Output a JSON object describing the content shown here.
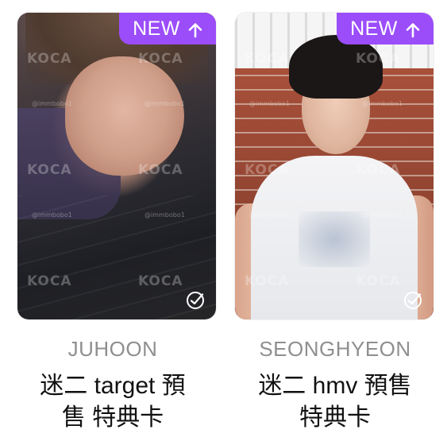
{
  "colors": {
    "badge": "#9b4dfa",
    "member_text": "#8f8f8f",
    "title_text": "#111111"
  },
  "cards": [
    {
      "badge_label": "NEW",
      "badge_icon": "arrow-up-icon",
      "selected_icon": "check-circle-icon",
      "watermark": "KOCA",
      "watermark_handle": "@immbobo1",
      "member": "JUHOON",
      "title_line1": "迷二 target 預",
      "title_line2": "售 特典卡"
    },
    {
      "badge_label": "NEW",
      "badge_icon": "arrow-up-icon",
      "selected_icon": "check-circle-icon",
      "watermark": "KOCA",
      "watermark_handle": "@immbobo1",
      "member": "SEONGHYEON",
      "title_line1": "迷二 hmv 預售",
      "title_line2": "特典卡"
    }
  ]
}
